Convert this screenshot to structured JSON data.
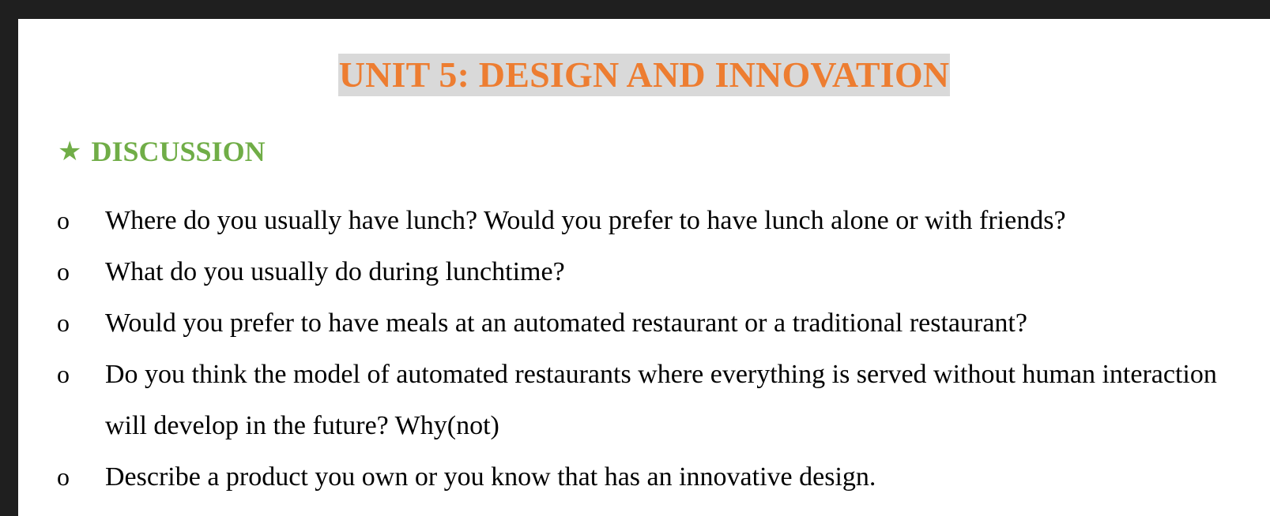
{
  "document": {
    "title": "UNIT 5: DESIGN AND INNOVATION",
    "section": {
      "star": "★",
      "heading": "DISCUSSION"
    },
    "bullet_glyph": "o",
    "questions": [
      "Where do you usually have lunch? Would you prefer to have lunch alone or with friends?",
      "What do you usually do during lunchtime?",
      "Would you prefer to have meals at an automated restaurant or a traditional restaurant?",
      "Do you think the model of automated restaurants where everything is served without human interaction will develop in the future? Why(not)",
      "Describe a product you own or you know that has an innovative design."
    ]
  },
  "colors": {
    "title_text": "#ed7d31",
    "title_highlight": "#d9d9d9",
    "section_heading": "#70ad47",
    "body_text": "#000000",
    "window_frame": "#1f1f1f",
    "page_background": "#ffffff"
  }
}
